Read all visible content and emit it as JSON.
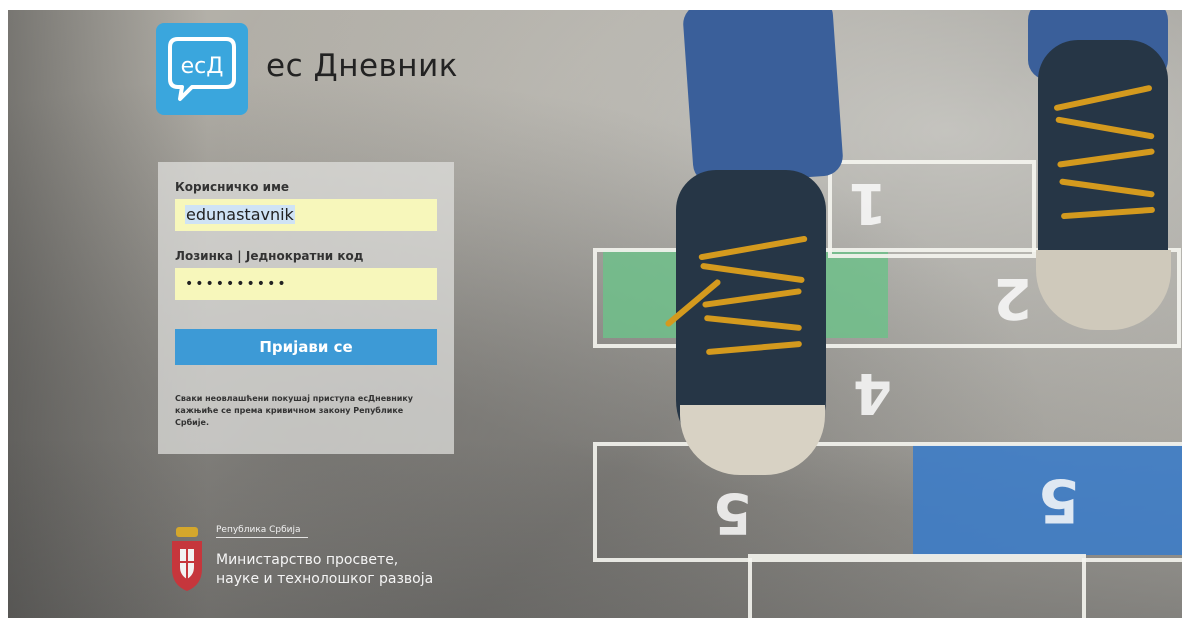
{
  "brand": {
    "logo_text": "ecД",
    "name": "ес Дневник",
    "logo_color": "#3aa6dd"
  },
  "login": {
    "username_label": "Корисничко име",
    "username_value": "edunastavnik",
    "password_label": "Лозинка | Једнократни код",
    "password_value": "••••••••••",
    "submit_label": "Пријави се",
    "button_color": "#3d9ad6",
    "field_color": "#f7f7bb",
    "notice": "Сваки неовлашћени покушај приступа есДневнику кажњиће се према кривичном закону Републике Србије."
  },
  "ministry": {
    "republic": "Република Србија",
    "line1": "Министарство просвете,",
    "line2": "науке и технолошког развоја",
    "icon": "serbia-coat-of-arms-icon"
  },
  "background": {
    "hopscotch_numbers": [
      "1",
      "2",
      "4",
      "5",
      "5"
    ]
  }
}
